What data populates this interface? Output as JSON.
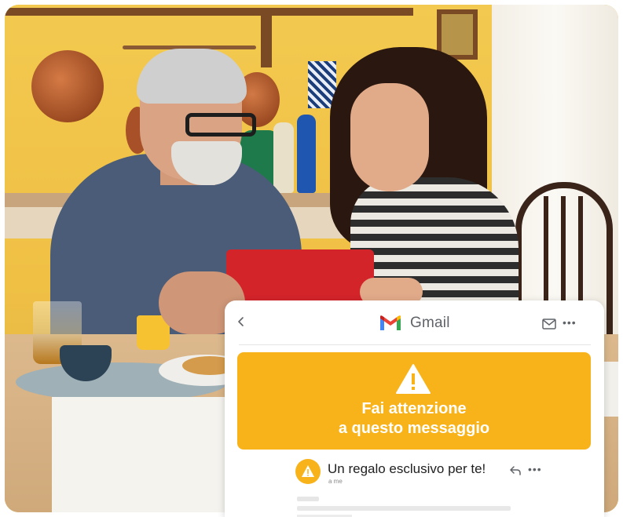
{
  "photo": {
    "description_icon": "family-at-kitchen-table-photo"
  },
  "gmail_card": {
    "brand_name": "Gmail",
    "icons": {
      "back": "chevron-left-icon",
      "logo": "gmail-logo-icon",
      "mail": "mail-envelope-icon",
      "more": "more-horizontal-icon"
    },
    "warning": {
      "line1": "Fai attenzione",
      "line2": "a questo messaggio",
      "icon": "warning-triangle-icon",
      "color": "#f8b31a"
    },
    "message": {
      "subject": "Un regalo esclusivo per te!",
      "recipient": "a me",
      "avatar_icon": "warning-triangle-icon",
      "reply_icon": "reply-icon",
      "more_icon": "more-horizontal-icon"
    }
  },
  "colors": {
    "warning": "#f8b31a",
    "gmail_red": "#ea4335",
    "gmail_blue": "#4285f4",
    "gmail_green": "#34a853",
    "gmail_yellow": "#fbbc04"
  }
}
